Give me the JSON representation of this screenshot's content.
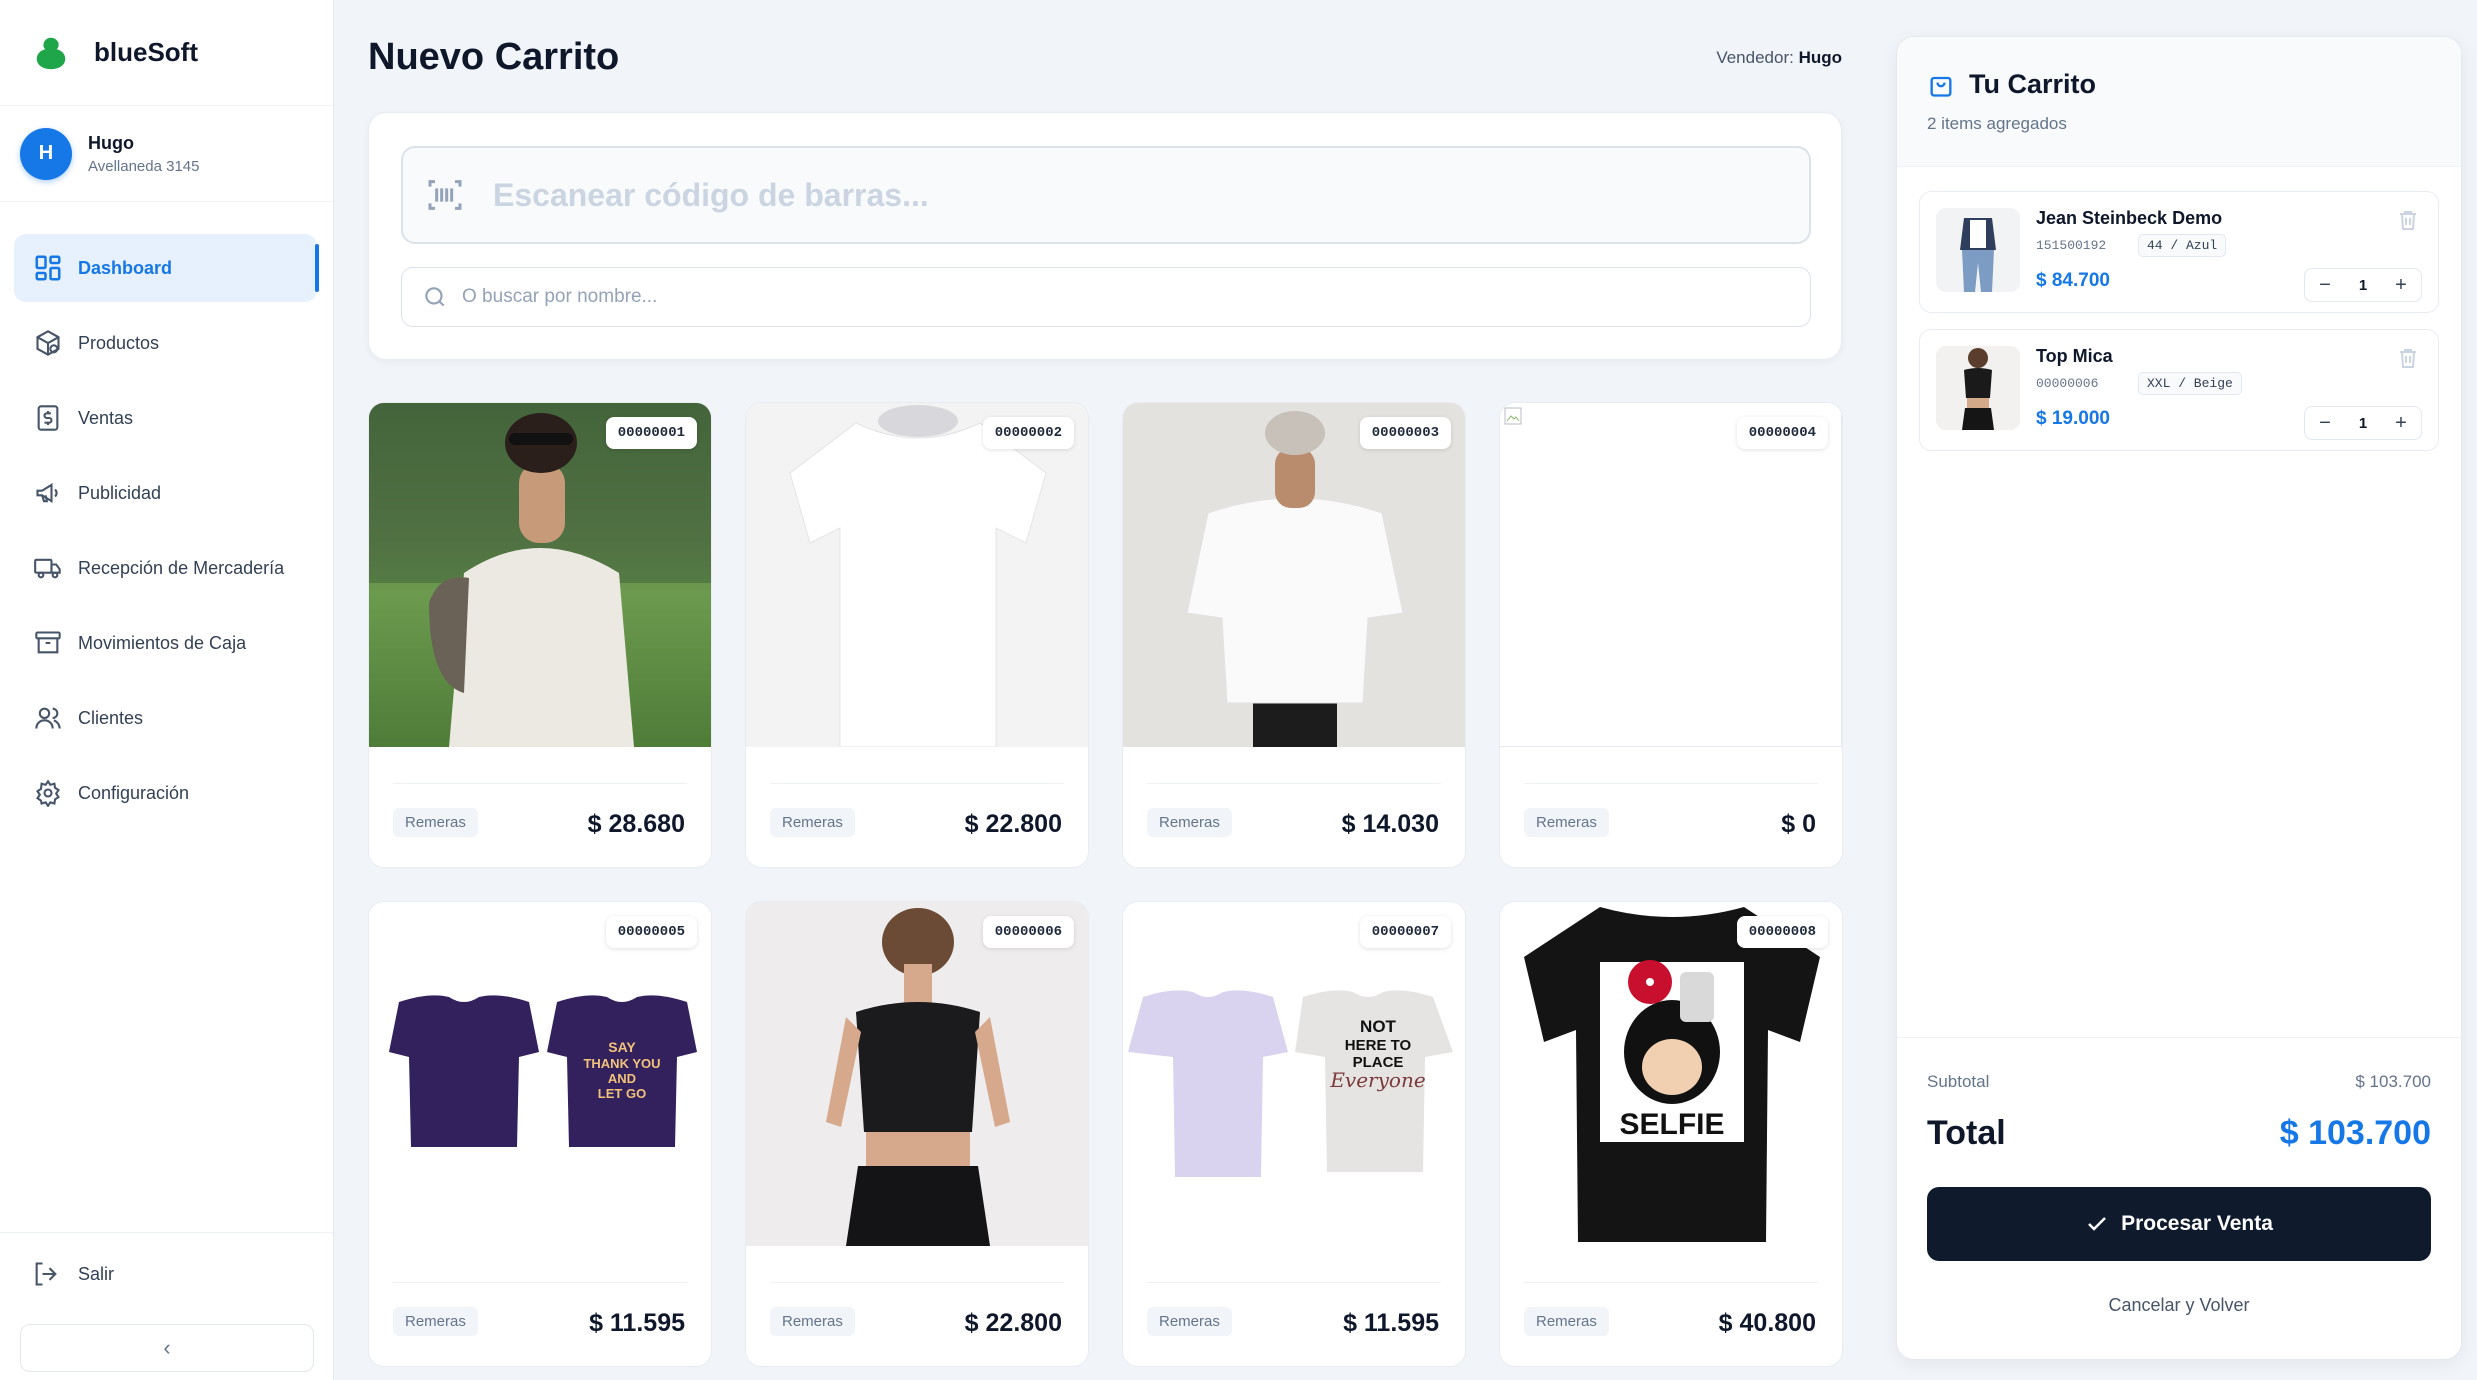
{
  "brand": {
    "name": "blueSoft",
    "color": "#1fa64a"
  },
  "user": {
    "initial": "H",
    "name": "Hugo",
    "address": "Avellaneda 3145"
  },
  "sidebar": {
    "items": [
      {
        "label": "Dashboard",
        "icon": "dashboard-icon",
        "active": true
      },
      {
        "label": "Productos",
        "icon": "products-icon"
      },
      {
        "label": "Ventas",
        "icon": "sales-icon"
      },
      {
        "label": "Publicidad",
        "icon": "megaphone-icon"
      },
      {
        "label": "Recepción de Mercadería",
        "icon": "truck-icon"
      },
      {
        "label": "Movimientos de Caja",
        "icon": "archive-icon"
      },
      {
        "label": "Clientes",
        "icon": "users-icon"
      },
      {
        "label": "Configuración",
        "icon": "gear-icon"
      }
    ],
    "logout_label": "Salir",
    "collapse_symbol": "‹"
  },
  "header": {
    "title": "Nuevo Carrito",
    "seller_label": "Vendedor:",
    "seller_name": "Hugo"
  },
  "search": {
    "barcode_placeholder": "Escanear código de barras...",
    "name_placeholder": "O buscar por nombre..."
  },
  "products": [
    {
      "code": "00000001",
      "category": "Remeras",
      "price": "$ 28.680"
    },
    {
      "code": "00000002",
      "category": "Remeras",
      "price": "$ 22.800"
    },
    {
      "code": "00000003",
      "category": "Remeras",
      "price": "$ 14.030"
    },
    {
      "code": "00000004",
      "category": "Remeras",
      "price": "$ 0"
    },
    {
      "code": "00000005",
      "category": "Remeras",
      "price": "$ 11.595"
    },
    {
      "code": "00000006",
      "category": "Remeras",
      "price": "$ 22.800"
    },
    {
      "code": "00000007",
      "category": "Remeras",
      "price": "$ 11.595"
    },
    {
      "code": "00000008",
      "category": "Remeras",
      "price": "$ 40.800"
    }
  ],
  "cart": {
    "title": "Tu Carrito",
    "subtitle": "2 items agregados",
    "items": [
      {
        "name": "Jean Steinbeck Demo",
        "code": "151500192",
        "variant": "44 / Azul",
        "price": "$ 84.700",
        "qty": "1"
      },
      {
        "name": "Top Mica",
        "code": "00000006",
        "variant": "XXL / Beige",
        "price": "$ 19.000",
        "qty": "1"
      }
    ],
    "subtotal_label": "Subtotal",
    "subtotal_value": "$ 103.700",
    "total_label": "Total",
    "total_value": "$ 103.700",
    "process_label": "Procesar Venta",
    "cancel_label": "Cancelar y Volver"
  },
  "colors": {
    "accent": "#1677e6",
    "primary_button": "#0f1b2d"
  }
}
